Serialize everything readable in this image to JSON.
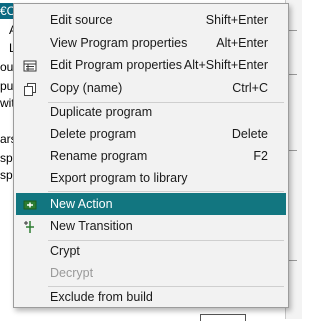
{
  "background": {
    "tree_fragments": [
      "€Cc",
      "A",
      "L",
      "ou",
      "pu",
      "wit",
      "ars",
      "spi",
      "spi"
    ]
  },
  "menu": {
    "items": [
      {
        "label": "Edit source",
        "shortcut": "Shift+Enter",
        "icon": null
      },
      {
        "label": "View Program properties",
        "shortcut": "Alt+Enter",
        "icon": null
      },
      {
        "label": "Edit Program properties",
        "shortcut": "Alt+Shift+Enter",
        "icon": "properties-grid-icon"
      },
      {
        "label": "Copy (name)",
        "shortcut": "Ctrl+C",
        "icon": "copy-icon"
      },
      {
        "label": "Duplicate program",
        "shortcut": "",
        "icon": null
      },
      {
        "label": "Delete program",
        "shortcut": "Delete",
        "icon": null
      },
      {
        "label": "Rename program",
        "shortcut": "F2",
        "icon": null
      },
      {
        "label": "Export program to library",
        "shortcut": "",
        "icon": null
      },
      {
        "label": "New Action",
        "shortcut": "",
        "icon": "new-action-icon",
        "highlighted": true
      },
      {
        "label": "New Transition",
        "shortcut": "",
        "icon": "new-transition-icon"
      },
      {
        "label": "Crypt",
        "shortcut": "",
        "icon": null
      },
      {
        "label": "Decrypt",
        "shortcut": "",
        "icon": null,
        "disabled": true
      },
      {
        "label": "Exclude from build",
        "shortcut": "",
        "icon": null
      }
    ],
    "highlight_color": "#127680"
  }
}
